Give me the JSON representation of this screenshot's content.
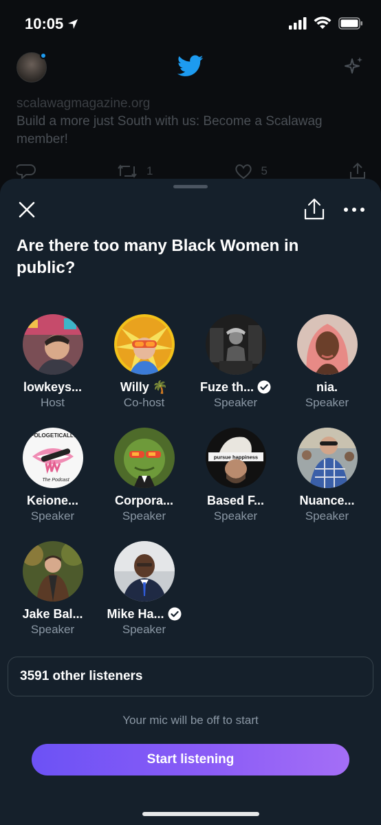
{
  "status_bar": {
    "time": "10:05"
  },
  "background": {
    "url": "scalawagmagazine.org",
    "text": "Build a more just South with us: Become a Scalawag member!",
    "retweets": "1",
    "likes": "5"
  },
  "space": {
    "title": "Are there too many Black Women in public?",
    "participants": [
      {
        "name": "lowkeys...",
        "role": "Host",
        "verified": false
      },
      {
        "name": "Willy 🌴",
        "role": "Co-host",
        "verified": false
      },
      {
        "name": "Fuze th...",
        "role": "Speaker",
        "verified": true
      },
      {
        "name": "nia.",
        "role": "Speaker",
        "verified": false
      },
      {
        "name": "Keione...",
        "role": "Speaker",
        "verified": false
      },
      {
        "name": "Corpora...",
        "role": "Speaker",
        "verified": false
      },
      {
        "name": "Based F...",
        "role": "Speaker",
        "verified": false
      },
      {
        "name": "Nuance...",
        "role": "Speaker",
        "verified": false
      },
      {
        "name": "Jake Bal...",
        "role": "Speaker",
        "verified": false
      },
      {
        "name": "Mike Ha...",
        "role": "Speaker",
        "verified": true
      }
    ],
    "avatar_text": {
      "keione_banner": "#MAPOLOGETICALLY KEI",
      "keione_footer": "The Podcast",
      "based_hat": "pursue happiness"
    },
    "listeners": "3591 other listeners",
    "mic_note": "Your mic will be off to start",
    "start_button": "Start listening"
  },
  "colors": {
    "sheet_bg": "#15202b",
    "secondary_text": "#8b98a5",
    "twitter_blue": "#1d9bf0",
    "button_gradient_start": "#6c52f5",
    "button_gradient_end": "#a46ef6"
  },
  "icons": [
    "location-arrow-icon",
    "signal-icon",
    "wifi-icon",
    "battery-icon",
    "twitter-bird-icon",
    "sparkle-icon",
    "reply-icon",
    "retweet-icon",
    "like-icon",
    "share-icon",
    "close-icon",
    "more-icon",
    "verified-icon"
  ]
}
